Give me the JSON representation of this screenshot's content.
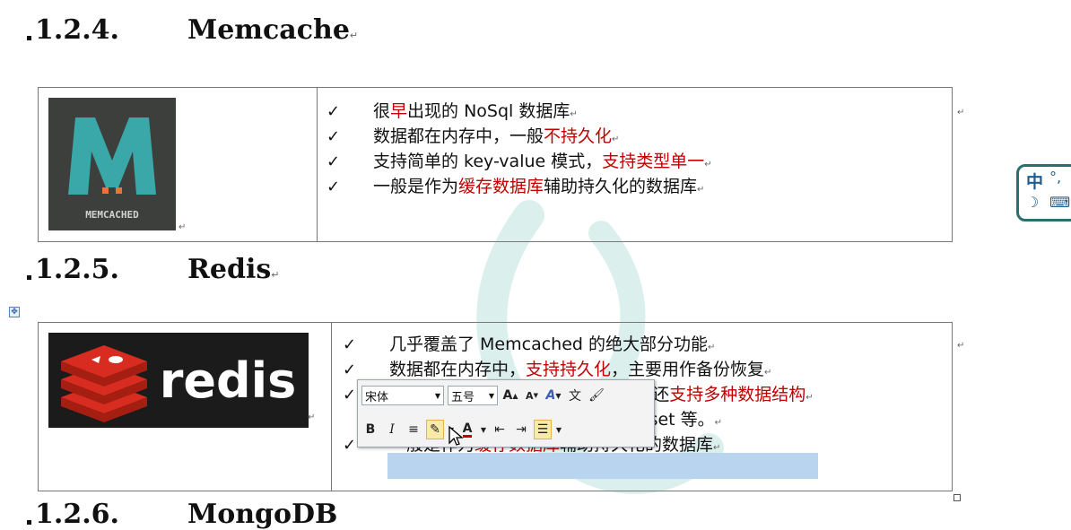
{
  "section_memcache": {
    "number": "1.2.4.",
    "title": "Memcache",
    "logo_text": "MEMCACHED",
    "items": [
      {
        "parts": [
          {
            "t": "很",
            "c": ""
          },
          {
            "t": "早",
            "c": "red"
          },
          {
            "t": "出现的 NoSql 数据库",
            "c": ""
          }
        ]
      },
      {
        "parts": [
          {
            "t": "数据都在内存中，一般",
            "c": ""
          },
          {
            "t": "不持久化",
            "c": "red"
          }
        ]
      },
      {
        "parts": [
          {
            "t": "支持简单的 key-value 模式，",
            "c": ""
          },
          {
            "t": "支持类型单一",
            "c": "red"
          }
        ]
      },
      {
        "parts": [
          {
            "t": "一般是作为",
            "c": ""
          },
          {
            "t": "缓存数据库",
            "c": "red"
          },
          {
            "t": "辅助持久化的数据库",
            "c": ""
          }
        ]
      }
    ]
  },
  "section_redis": {
    "number": "1.2.5.",
    "title": "Redis",
    "logo_text": "redis",
    "items": [
      {
        "parts": [
          {
            "t": "几乎覆盖了 Memcached 的绝大部分功能",
            "c": ""
          }
        ]
      },
      {
        "parts": [
          {
            "t": "数据都在内存中，",
            "c": ""
          },
          {
            "t": "支持持久化",
            "c": "red"
          },
          {
            "t": "，主要用作备份恢复",
            "c": ""
          }
        ]
      },
      {
        "parts": [
          {
            "t": "除了支持简单的 key-value 模式，还",
            "c": ""
          },
          {
            "t": "支持多种数据结构",
            "c": "red"
          }
        ]
      },
      {
        "parts": [
          {
            "t": "的存储，比如 list、set、hash、zset 等。",
            "c": ""
          }
        ]
      },
      {
        "parts": [
          {
            "t": "一般是作为",
            "c": ""
          },
          {
            "t": "缓存数据库",
            "c": "red"
          },
          {
            "t": "辅助持久化的数据库",
            "c": ""
          }
        ]
      }
    ]
  },
  "next_section": {
    "number": "1.2.6.",
    "title": "MongoDB"
  },
  "toolbar": {
    "font_name": "宋体",
    "font_size": "五号",
    "bold": "B",
    "italic": "I",
    "font_color_glyph": "A"
  },
  "ime": {
    "label": "中"
  },
  "colors": {
    "red": "#c00000",
    "selection": "#b9d4ee",
    "redis_red": "#d82c20"
  }
}
